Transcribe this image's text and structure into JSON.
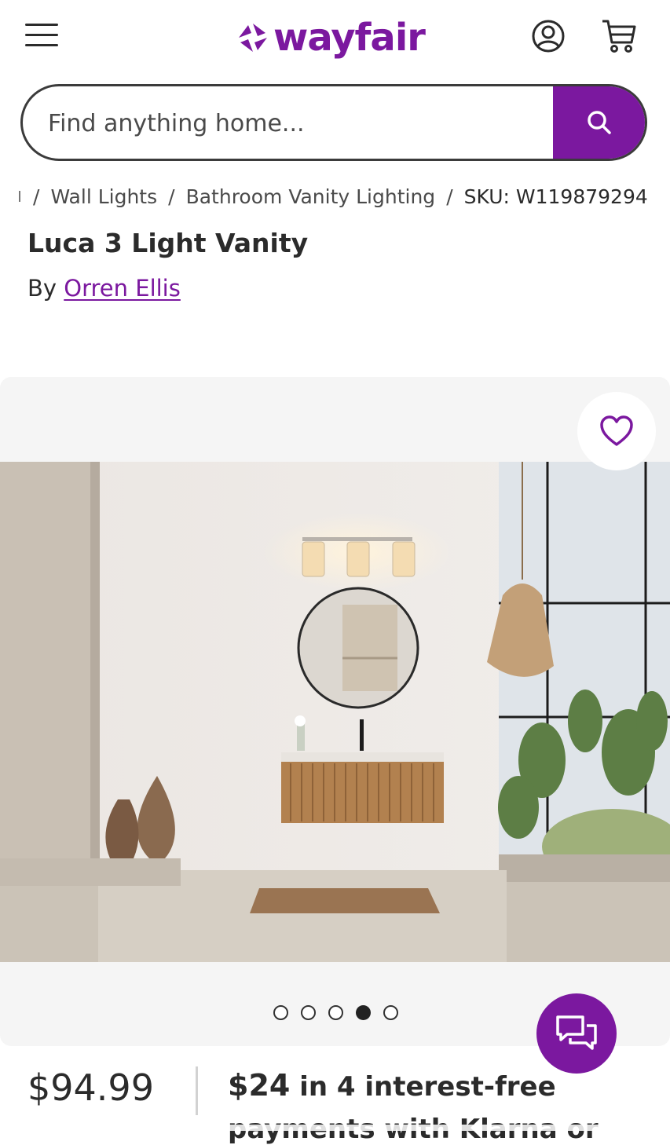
{
  "header": {
    "logo_text": "wayfair",
    "brand_color": "#7b189f",
    "icons": [
      "hamburger-menu-icon",
      "account-icon",
      "cart-icon"
    ]
  },
  "search": {
    "placeholder": "Find anything home...",
    "button_icon": "search-icon"
  },
  "breadcrumb": {
    "items": [
      "Wall Lights",
      "Bathroom Vanity Lighting"
    ],
    "sku": "SKU: W119879294"
  },
  "product": {
    "title": "Luca 3 Light Vanity",
    "by_label": "By",
    "brand": "Orren Ellis"
  },
  "gallery": {
    "favorite_icon": "heart-icon",
    "image_alt": "Bathroom with three-light vanity fixture above round mirror and wooden vanity",
    "dot_count": 5,
    "active_index": 3
  },
  "chat": {
    "icon": "chat-bubbles-icon"
  },
  "pricing": {
    "price": "$94.99",
    "installment_amount": "$24",
    "installment_text": " in 4 interest-free",
    "installment_line2": "payments with Klarna or"
  }
}
